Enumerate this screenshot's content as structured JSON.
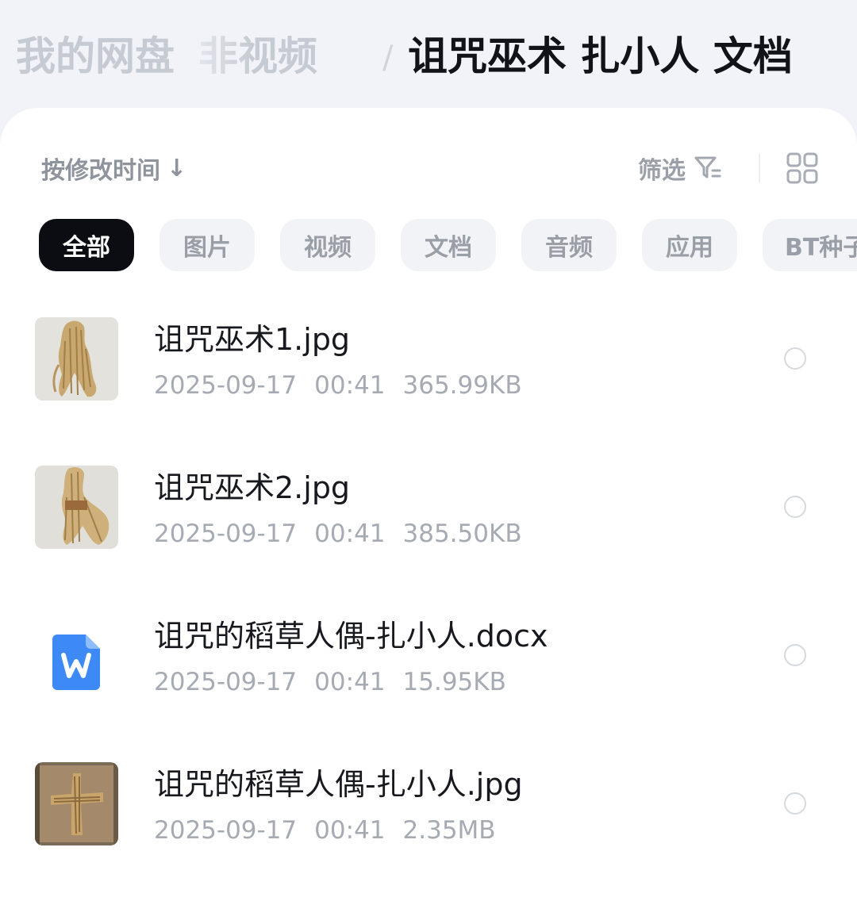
{
  "breadcrumb": {
    "root": "我的网盘",
    "middle": "非视频",
    "separator": "/",
    "current": "诅咒巫术 扎小人 文档"
  },
  "toolbar": {
    "sort_label": "按修改时间",
    "sort_arrow": "↓",
    "filter_label": "筛选",
    "filter_icon": "filter-icon",
    "view_icon": "grid-view-icon"
  },
  "chips": [
    {
      "label": "全部",
      "active": true
    },
    {
      "label": "图片",
      "active": false
    },
    {
      "label": "视频",
      "active": false
    },
    {
      "label": "文档",
      "active": false
    },
    {
      "label": "音频",
      "active": false
    },
    {
      "label": "应用",
      "active": false
    },
    {
      "label": "BT种子",
      "active": false
    }
  ],
  "files": [
    {
      "name": "诅咒巫术1.jpg",
      "date": "2025-09-17",
      "time": "00:41",
      "size": "365.99KB",
      "icon": "image-thumbnail"
    },
    {
      "name": "诅咒巫术2.jpg",
      "date": "2025-09-17",
      "time": "00:41",
      "size": "385.50KB",
      "icon": "image-thumbnail"
    },
    {
      "name": "诅咒的稻草人偶-扎小人.docx",
      "date": "2025-09-17",
      "time": "00:41",
      "size": "15.95KB",
      "icon": "word-doc-icon"
    },
    {
      "name": "诅咒的稻草人偶-扎小人.jpg",
      "date": "2025-09-17",
      "time": "00:41",
      "size": "2.35MB",
      "icon": "image-thumbnail"
    }
  ],
  "colors": {
    "active_chip": "#0b0d12",
    "chip_bg": "#f2f3f6",
    "word_blue": "#3d8af7"
  }
}
